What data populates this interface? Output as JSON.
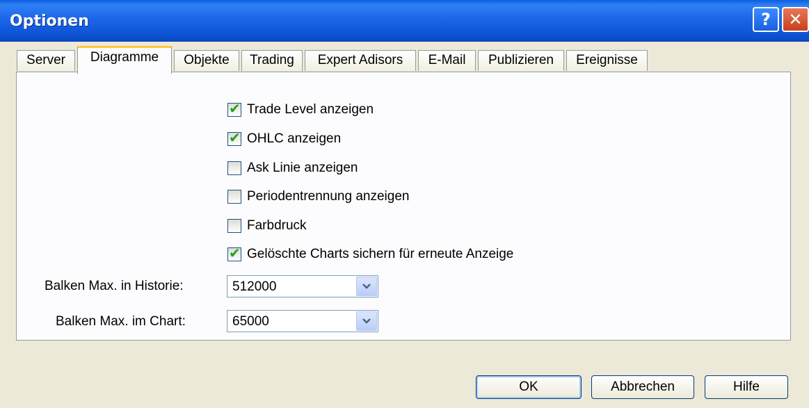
{
  "window": {
    "title": "Optionen",
    "help_glyph": "?",
    "close_glyph": "✕"
  },
  "tabs": [
    {
      "label": "Server"
    },
    {
      "label": "Diagramme",
      "active": true
    },
    {
      "label": "Objekte"
    },
    {
      "label": "Trading"
    },
    {
      "label": "Expert Adisors"
    },
    {
      "label": "E-Mail"
    },
    {
      "label": "Publizieren"
    },
    {
      "label": "Ereignisse"
    }
  ],
  "checkboxes": [
    {
      "label": "Trade Level anzeigen",
      "checked": true
    },
    {
      "label": "OHLC anzeigen",
      "checked": true
    },
    {
      "label": "Ask Linie anzeigen",
      "checked": false
    },
    {
      "label": "Periodentrennung anzeigen",
      "checked": false
    },
    {
      "label": "Farbdruck",
      "checked": false
    },
    {
      "label": "Gelöschte Charts sichern für erneute Anzeige",
      "checked": true
    }
  ],
  "fields": {
    "history": {
      "label": "Balken Max. in Historie:",
      "value": "512000"
    },
    "chart": {
      "label": "Balken Max. im Chart:",
      "value": "65000"
    }
  },
  "buttons": {
    "ok": "OK",
    "cancel": "Abbrechen",
    "help": "Hilfe"
  },
  "colors": {
    "titlebar": "#0e55d6",
    "active_tab_accent": "#ffc83c",
    "check": "#21a121"
  }
}
